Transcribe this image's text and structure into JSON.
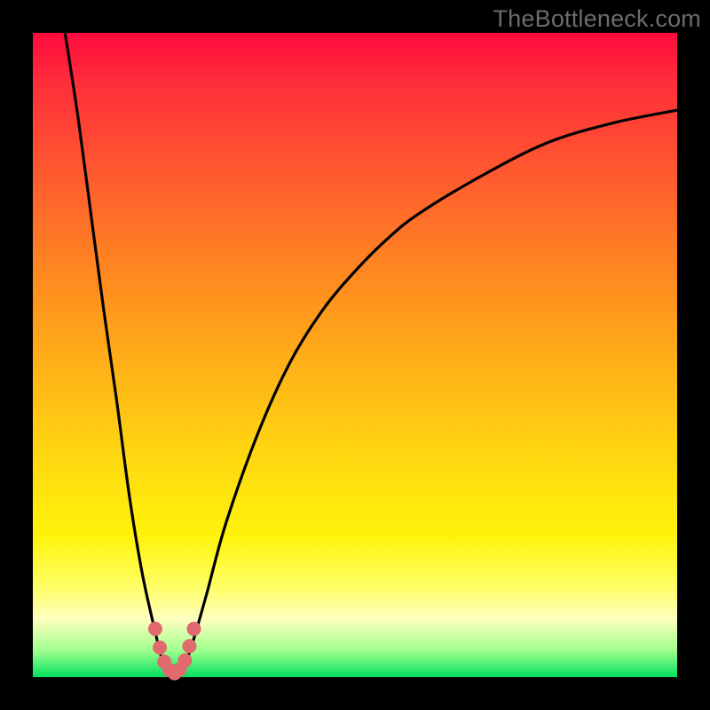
{
  "watermark": "TheBottleneck.com",
  "colors": {
    "frame": "#000000",
    "curve_stroke": "#000000",
    "marker_fill": "#e16a6f",
    "gradient_stops": [
      "#ff0a3e",
      "#ff5a2f",
      "#ffb218",
      "#fff30a",
      "#ffffc0",
      "#00e060"
    ]
  },
  "chart_data": {
    "type": "line",
    "title": "",
    "xlabel": "",
    "ylabel": "",
    "xlim": [
      0,
      100
    ],
    "ylim": [
      0,
      100
    ],
    "grid": false,
    "legend": false,
    "annotations": [],
    "note": "x is a normalized hardware-capability axis (0–100, unlabeled). y is bottleneck percentage (0 at bottom = no bottleneck, 100 at top = fully bottlenecked). Gradient encodes y: green ≈ low bottleneck, red ≈ high.",
    "series": [
      {
        "name": "bottleneck-curve",
        "x": [
          5,
          7,
          9,
          11,
          13,
          15,
          17,
          19,
          20,
          21,
          22,
          23,
          24,
          25,
          27,
          30,
          35,
          40,
          45,
          50,
          55,
          60,
          70,
          80,
          90,
          100
        ],
        "y": [
          100,
          87,
          72,
          57,
          43,
          28,
          16,
          7,
          3,
          1,
          0,
          1,
          3,
          6,
          13,
          24,
          38,
          49,
          57,
          63,
          68,
          72,
          78,
          83,
          86,
          88
        ]
      }
    ],
    "minimum_markers": {
      "name": "near-minimum-points",
      "x": [
        19.0,
        19.7,
        20.4,
        21.2,
        22.0,
        22.8,
        23.6,
        24.3,
        25.0
      ],
      "y": [
        7.5,
        4.6,
        2.4,
        1.1,
        0.6,
        1.2,
        2.6,
        4.8,
        7.5
      ]
    }
  }
}
